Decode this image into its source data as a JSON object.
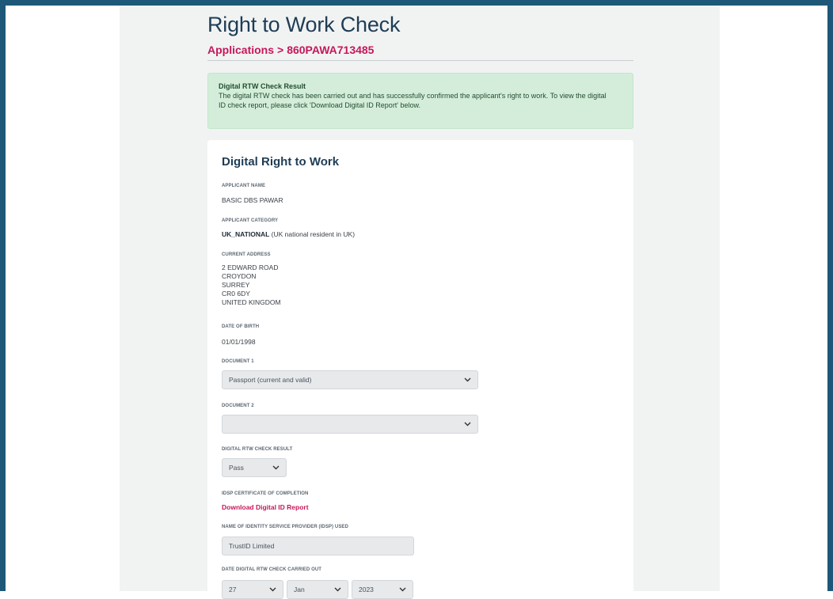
{
  "page": {
    "title": "Right to Work Check",
    "breadcrumb": {
      "root": "Applications",
      "separator": ">",
      "current": "860PAWA713485"
    }
  },
  "alert": {
    "title": "Digital RTW Check Result",
    "text": "The digital RTW check has been carried out and has successfully confirmed the applicant's right to work. To view the digital ID check report, please click 'Download Digital ID Report' below."
  },
  "card": {
    "title": "Digital Right to Work",
    "applicant_name": {
      "label": "APPLICANT NAME",
      "value": "BASIC DBS   PAWAR"
    },
    "applicant_category": {
      "label": "APPLICANT CATEGORY",
      "code": "UK_NATIONAL",
      "description": "(UK national resident in UK)"
    },
    "current_address": {
      "label": "CURRENT ADDRESS",
      "lines": [
        "2 EDWARD ROAD",
        "CROYDON",
        "SURREY",
        "CR0 6DY",
        "UNITED KINGDOM"
      ]
    },
    "date_of_birth": {
      "label": "DATE OF BIRTH",
      "value": "01/01/1998"
    },
    "document_1": {
      "label": "DOCUMENT 1",
      "selected": "Passport (current and valid)"
    },
    "document_2": {
      "label": "DOCUMENT 2",
      "selected": ""
    },
    "rtw_result": {
      "label": "DIGITAL RTW CHECK RESULT",
      "selected": "Pass"
    },
    "idsp_certificate": {
      "label": "IDSP CERTIFICATE OF COMPLETION",
      "link": "Download Digital ID Report"
    },
    "idsp_name": {
      "label": "NAME OF IDENTITY SERVICE PROVIDER (IDSP) USED",
      "value": "TrustID Limited"
    },
    "check_date": {
      "label": "DATE DIGITAL RTW CHECK CARRIED OUT",
      "day": "27",
      "month": "Jan",
      "year": "2023"
    }
  },
  "icons": {
    "select_arrow": "chevron-down-icon"
  },
  "colors": {
    "frame": "#1d5878",
    "accent": "#c6175a",
    "title": "#1f3d55",
    "alert_bg": "#d4edda"
  }
}
